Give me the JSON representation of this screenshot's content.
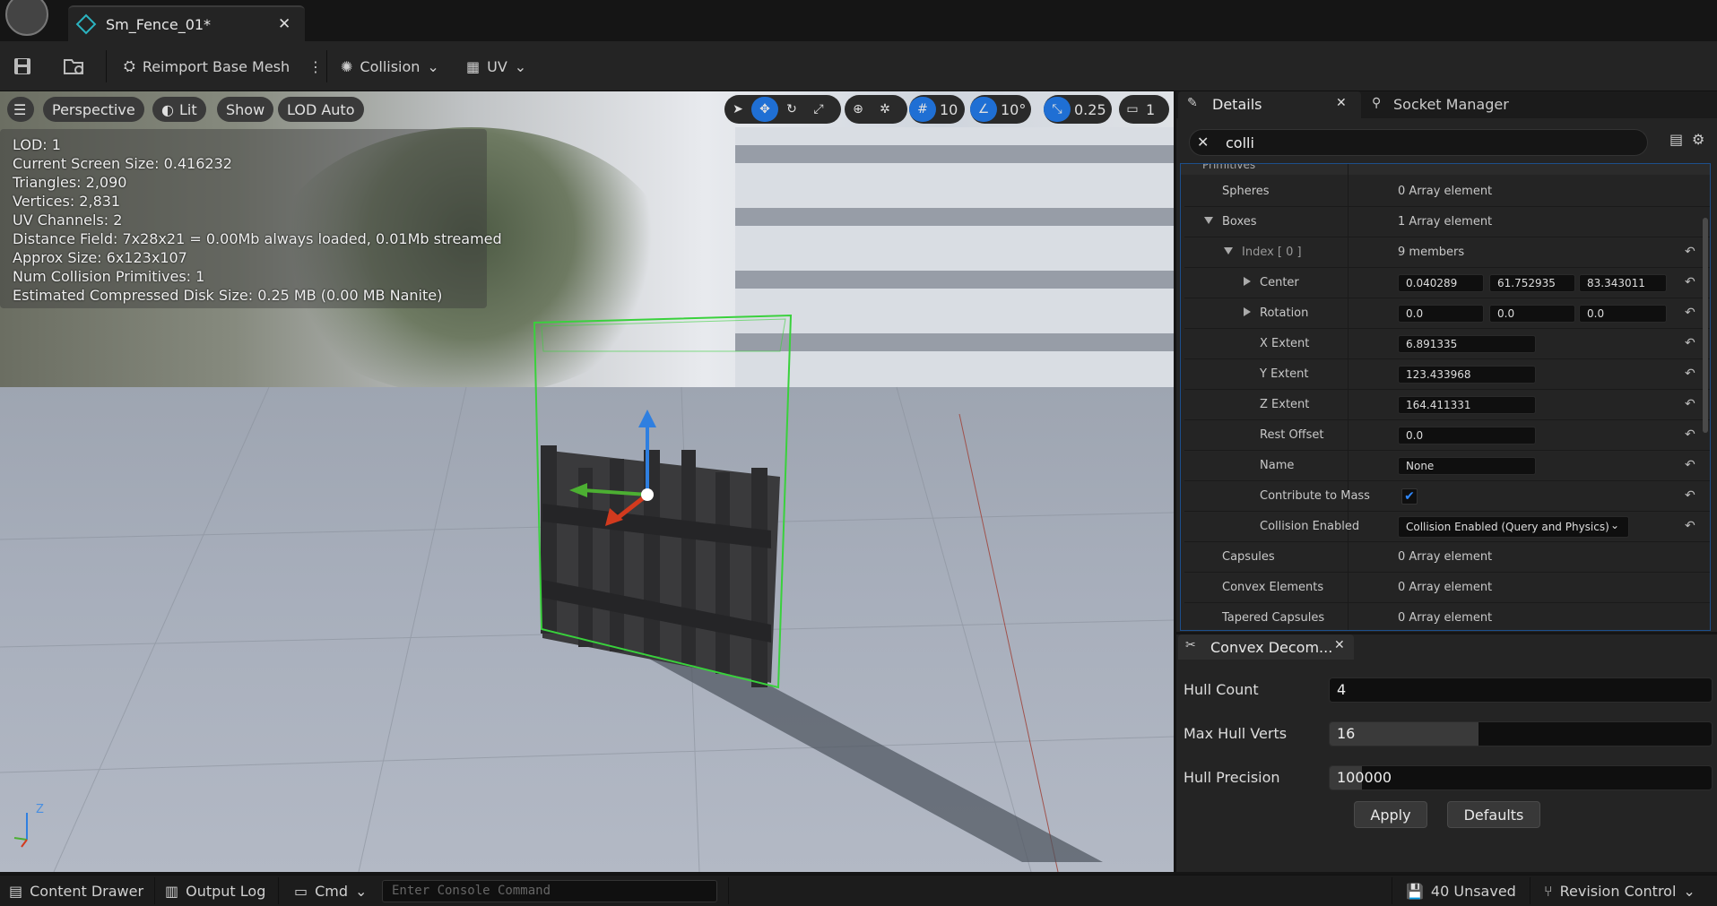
{
  "tab": {
    "title": "Sm_Fence_01*"
  },
  "toolbar": {
    "reimport_label": "Reimport Base Mesh",
    "collision_label": "Collision",
    "uv_label": "UV"
  },
  "viewport": {
    "perspective_label": "Perspective",
    "lit_label": "Lit",
    "show_label": "Show",
    "lod_label": "LOD Auto",
    "grid_snap": "10",
    "rot_snap": "10°",
    "scale_snap": "0.25",
    "camera_speed": "1",
    "axis_z": "Z",
    "stats": [
      "LOD:  1",
      "Current Screen Size:  0.416232",
      "Triangles:  2,090",
      "Vertices:  2,831",
      "UV Channels:  2",
      "Distance Field:  7x28x21 = 0.00Mb always loaded, 0.01Mb streamed",
      "Approx Size: 6x123x107",
      "Num Collision Primitives:  1",
      "Estimated Compressed Disk Size: 0.25 MB (0.00 MB Nanite)"
    ]
  },
  "details": {
    "tab_label": "Details",
    "socket_tab_label": "Socket Manager",
    "search_value": "colli",
    "section_label": "Primitives",
    "rows": {
      "spheres_label": "Spheres",
      "spheres_value": "0 Array element",
      "boxes_label": "Boxes",
      "boxes_value": "1 Array element",
      "index_label": "Index [ 0 ]",
      "index_value": "9 members",
      "center_label": "Center",
      "center_x": "0.040289",
      "center_y": "61.752935",
      "center_z": "83.343011",
      "rotation_label": "Rotation",
      "rot_x": "0.0",
      "rot_y": "0.0",
      "rot_z": "0.0",
      "xext_label": "X Extent",
      "xext_value": "6.891335",
      "yext_label": "Y Extent",
      "yext_value": "123.433968",
      "zext_label": "Z Extent",
      "zext_value": "164.411331",
      "rest_label": "Rest Offset",
      "rest_value": "0.0",
      "name_label": "Name",
      "name_value": "None",
      "mass_label": "Contribute to Mass",
      "coll_label": "Collision Enabled",
      "coll_value": "Collision Enabled (Query and Physics)",
      "capsules_label": "Capsules",
      "capsules_value": "0 Array element",
      "convex_label": "Convex Elements",
      "convex_value": "0 Array element",
      "tapered_label": "Tapered Capsules",
      "tapered_value": "0 Array element"
    }
  },
  "convex": {
    "tab_label": "Convex Decom...",
    "hull_count_label": "Hull Count",
    "hull_count": "4",
    "max_verts_label": "Max Hull Verts",
    "max_verts": "16",
    "precision_label": "Hull Precision",
    "precision": "100000",
    "apply_label": "Apply",
    "defaults_label": "Defaults"
  },
  "statusbar": {
    "content_drawer": "Content Drawer",
    "output_log": "Output Log",
    "cmd": "Cmd",
    "console_placeholder": "Enter Console Command",
    "unsaved": "40 Unsaved",
    "revision": "Revision Control"
  },
  "colors": {
    "accent": "#1f6fd4",
    "collision_box": "#39d13c",
    "checkbox": "#1f6fd4"
  }
}
